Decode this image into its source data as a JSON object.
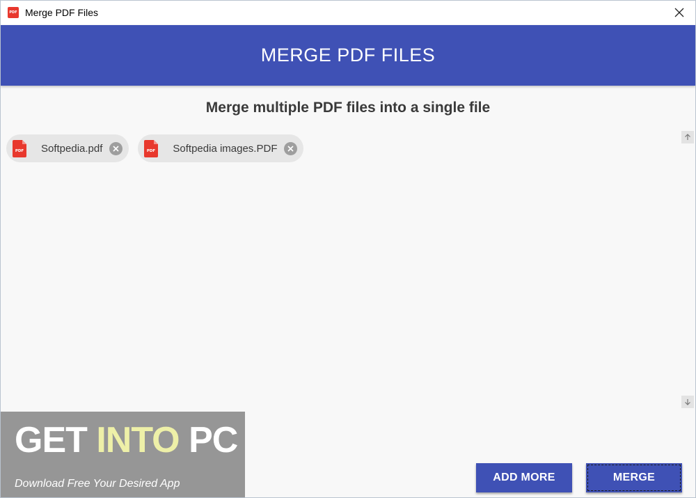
{
  "window": {
    "title": "Merge PDF Files",
    "app_icon_text": "PDF"
  },
  "header": {
    "title": "MERGE PDF FILES"
  },
  "main": {
    "subtitle": "Merge multiple PDF files into a single file",
    "files": [
      {
        "name": "Softpedia.pdf",
        "icon": "pdf-file-icon"
      },
      {
        "name": "Softpedia images.PDF",
        "icon": "pdf-file-icon"
      }
    ],
    "pdf_icon_text": "PDF"
  },
  "actions": {
    "add_more_label": "ADD MORE",
    "merge_label": "MERGE"
  },
  "watermark": {
    "title_part1": "GET ",
    "title_part2": "INTO",
    "title_part3": " PC",
    "subtitle": "Download Free Your Desired App"
  },
  "colors": {
    "primary": "#3f51b5",
    "pdf_red": "#e8382d",
    "chip_bg": "#e6e6e6"
  }
}
